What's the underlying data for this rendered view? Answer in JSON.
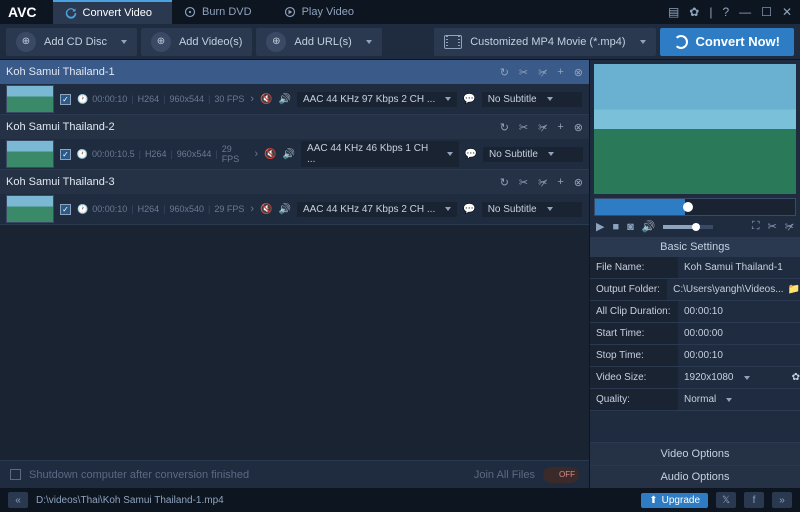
{
  "app": {
    "name": "AVC"
  },
  "tabs": [
    {
      "label": "Convert Video",
      "icon": "refresh"
    },
    {
      "label": "Burn DVD",
      "icon": "disc"
    },
    {
      "label": "Play Video",
      "icon": "play"
    }
  ],
  "toolbar": {
    "add_cd": "Add CD Disc",
    "add_videos": "Add Video(s)",
    "add_urls": "Add URL(s)",
    "profile": "Customized MP4 Movie (*.mp4)",
    "convert": "Convert Now!"
  },
  "files": [
    {
      "name": "Koh Samui Thailand-1",
      "duration": "00:00:10",
      "codec": "H264",
      "res": "960x544",
      "fps": "30 FPS",
      "audio": "AAC 44 KHz 97 Kbps 2 CH ...",
      "subtitle": "No Subtitle",
      "selected": true
    },
    {
      "name": "Koh Samui Thailand-2",
      "duration": "00:00:10.5",
      "codec": "H264",
      "res": "960x544",
      "fps": "29 FPS",
      "audio": "AAC 44 KHz 46 Kbps 1 CH ...",
      "subtitle": "No Subtitle",
      "selected": false
    },
    {
      "name": "Koh Samui Thailand-3",
      "duration": "00:00:10",
      "codec": "H264",
      "res": "960x540",
      "fps": "29 FPS",
      "audio": "AAC 44 KHz 47 Kbps 2 CH ...",
      "subtitle": "No Subtitle",
      "selected": false
    }
  ],
  "list_footer": {
    "shutdown": "Shutdown computer after conversion finished",
    "join": "Join All Files",
    "toggle": "OFF"
  },
  "settings": {
    "title": "Basic Settings",
    "filename_lbl": "File Name:",
    "filename": "Koh Samui Thailand-1",
    "output_lbl": "Output Folder:",
    "output": "C:\\Users\\yangh\\Videos...",
    "dur_lbl": "All Clip Duration:",
    "dur": "00:00:10",
    "start_lbl": "Start Time:",
    "start": "00:00:00",
    "stop_lbl": "Stop Time:",
    "stop": "00:00:10",
    "size_lbl": "Video Size:",
    "size": "1920x1080",
    "quality_lbl": "Quality:",
    "quality": "Normal",
    "video_opts": "Video Options",
    "audio_opts": "Audio Options"
  },
  "status": {
    "path": "D:\\videos\\Thai\\Koh Samui Thailand-1.mp4",
    "upgrade": "Upgrade"
  }
}
